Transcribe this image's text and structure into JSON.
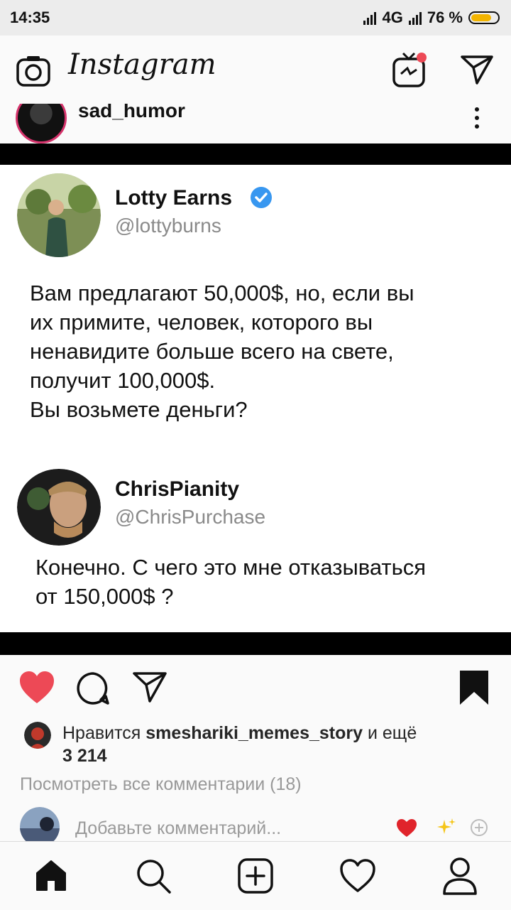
{
  "status_bar": {
    "time": "14:35",
    "network": "4G",
    "battery": "76 %"
  },
  "app": {
    "title": "Instagram"
  },
  "post": {
    "username": "sad_humor",
    "tweet1": {
      "name": "Lotty Earns",
      "handle": "@lottyburns",
      "lines": [
        "Вам предлагают 50,000$, но, если вы",
        "их примите, человек, которого вы",
        "ненавидите больше всего на свете,",
        "получит 100,000$.",
        "Вы возьмете деньги?"
      ]
    },
    "tweet2": {
      "name": "ChrisPianity",
      "handle": "@ChrisPurchase",
      "lines": [
        "Конечно. С чего это мне отказываться",
        "от 150,000$ ?"
      ]
    },
    "likes_prefix": "Нравится",
    "likes_user": "smeshariki_memes_story",
    "likes_suffix": "и ещё",
    "likes_count": "3 214",
    "view_comments": "Посмотреть все комментарии (18)",
    "comment_placeholder": "Добавьте комментарий..."
  },
  "colors": {
    "like_red": "#ed4956",
    "verified_blue": "#3897f0",
    "story_ring": "#d6336c"
  }
}
